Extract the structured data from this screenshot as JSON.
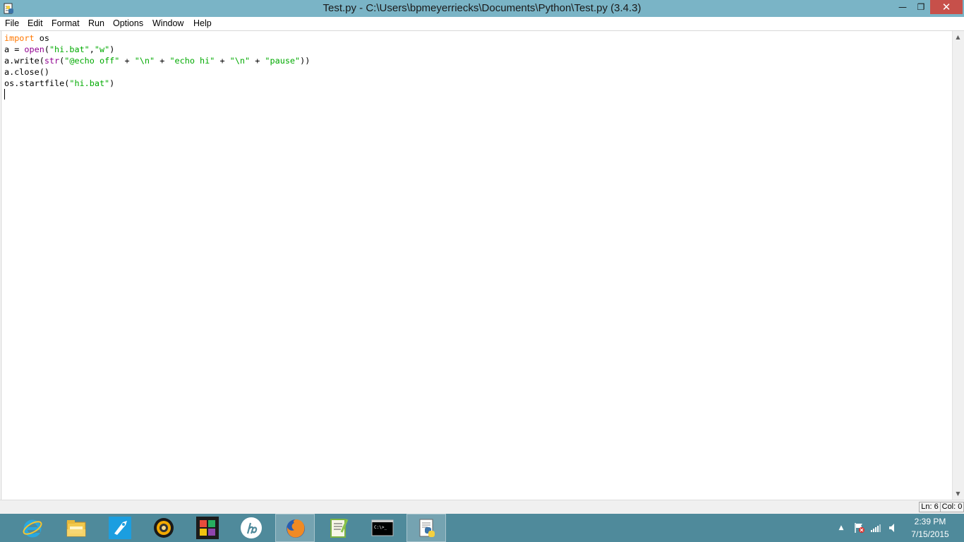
{
  "window": {
    "title": "Test.py - C:\\Users\\bpmeyerriecks\\Documents\\Python\\Test.py (3.4.3)",
    "minimize_label": "—",
    "maximize_label": "❐",
    "close_label": "✕"
  },
  "menu": {
    "items": [
      {
        "label": "File"
      },
      {
        "label": "Edit"
      },
      {
        "label": "Format"
      },
      {
        "label": "Run"
      },
      {
        "label": "Options"
      },
      {
        "label": "Window"
      },
      {
        "label": "Help"
      }
    ]
  },
  "editor": {
    "lines": [
      [
        {
          "t": "import",
          "c": "kw"
        },
        {
          "t": " os",
          "c": ""
        }
      ],
      [
        {
          "t": "a = ",
          "c": ""
        },
        {
          "t": "open",
          "c": "bi"
        },
        {
          "t": "(",
          "c": ""
        },
        {
          "t": "\"hi.bat\"",
          "c": "st"
        },
        {
          "t": ",",
          "c": ""
        },
        {
          "t": "\"w\"",
          "c": "st"
        },
        {
          "t": ")",
          "c": ""
        }
      ],
      [
        {
          "t": "a.write(",
          "c": ""
        },
        {
          "t": "str",
          "c": "bi"
        },
        {
          "t": "(",
          "c": ""
        },
        {
          "t": "\"@echo off\"",
          "c": "st"
        },
        {
          "t": " + ",
          "c": ""
        },
        {
          "t": "\"\\n\"",
          "c": "st"
        },
        {
          "t": " + ",
          "c": ""
        },
        {
          "t": "\"echo hi\"",
          "c": "st"
        },
        {
          "t": " + ",
          "c": ""
        },
        {
          "t": "\"\\n\"",
          "c": "st"
        },
        {
          "t": " + ",
          "c": ""
        },
        {
          "t": "\"pause\"",
          "c": "st"
        },
        {
          "t": "))",
          "c": ""
        }
      ],
      [
        {
          "t": "a.close()",
          "c": ""
        }
      ],
      [
        {
          "t": "os.startfile(",
          "c": ""
        },
        {
          "t": "\"hi.bat\"",
          "c": "st"
        },
        {
          "t": ")",
          "c": ""
        }
      ],
      []
    ]
  },
  "status": {
    "line": "Ln: 6",
    "col": "Col: 0"
  },
  "taskbar": {
    "apps": [
      {
        "name": "internet-explorer-icon"
      },
      {
        "name": "file-explorer-icon"
      },
      {
        "name": "rocket-app-icon"
      },
      {
        "name": "media-player-icon"
      },
      {
        "name": "puzzle-app-icon"
      },
      {
        "name": "hp-icon"
      },
      {
        "name": "firefox-icon"
      },
      {
        "name": "notepad-plus-plus-icon"
      },
      {
        "name": "command-prompt-icon"
      },
      {
        "name": "python-idle-icon"
      }
    ]
  },
  "tray": {
    "chevron": "▲",
    "time": "2:39 PM",
    "date": "7/15/2015"
  },
  "colors": {
    "titlebar": "#7ab4c6",
    "taskbar": "#4f8a9b",
    "keyword": "#ff7700",
    "builtin": "#900090",
    "string": "#00aa00",
    "close_button": "#c7504a"
  }
}
